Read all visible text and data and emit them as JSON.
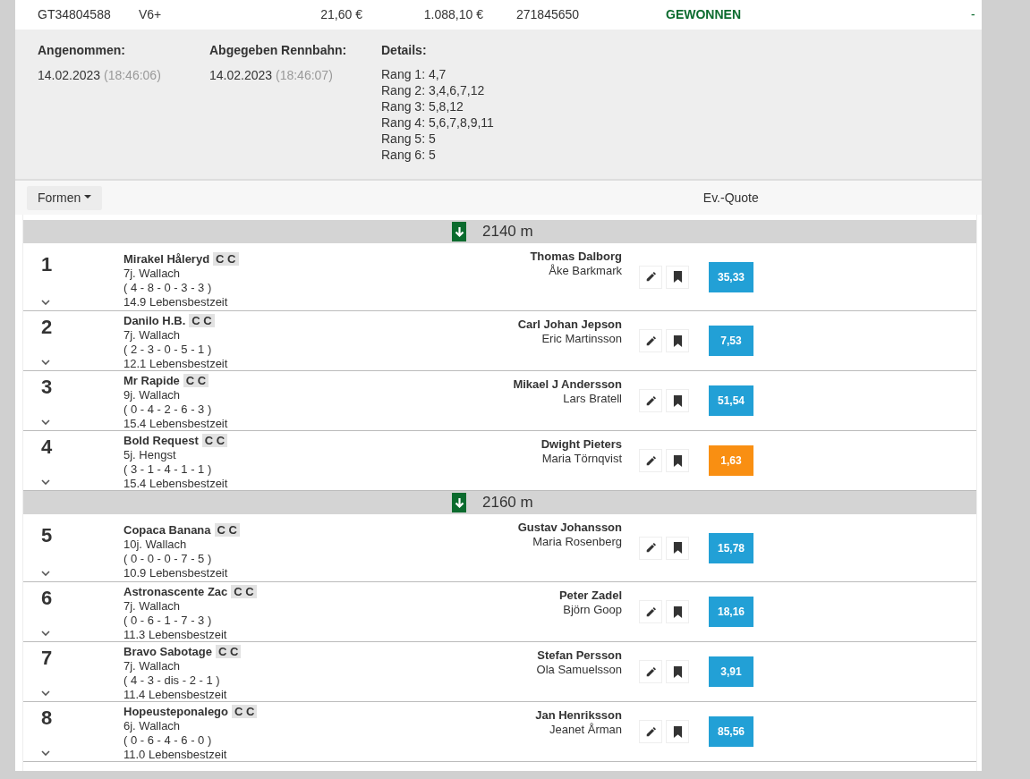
{
  "bet": {
    "id": "GT34804588",
    "type": "V6+",
    "stake": "21,60 €",
    "payout": "1.088,10 €",
    "number": "271845650",
    "status": "GEWONNEN",
    "result": "-"
  },
  "details": {
    "columns": [
      {
        "label": "Angenommen:",
        "date": "14.02.2023",
        "time": "(18:46:06)"
      },
      {
        "label": "Abgegeben Rennbahn:",
        "date": "14.02.2023",
        "time": "(18:46:07)"
      }
    ],
    "details_label": "Details:",
    "ranks": [
      "Rang 1: 4,7",
      "Rang 2: 3,4,6,7,12",
      "Rang 3: 5,8,12",
      "Rang 4: 5,6,7,8,9,11",
      "Rang 5: 5",
      "Rang 6: 5"
    ]
  },
  "toolbar": {
    "dropdown_label": "Formen",
    "column_label": "Ev.-Quote"
  },
  "groups": [
    {
      "distance": "2140 m",
      "runners": [
        {
          "number": "1",
          "name": "Mirakel Håleryd",
          "tag": "C C",
          "info": "7j. Wallach",
          "form": "( 4 - 8 - 0 - 3 - 3 )",
          "record": "14.9 Lebensbestzeit",
          "driver": "Thomas Dalborg",
          "trainer": "Åke Barkmark",
          "odds": "35,33",
          "favorite": false
        },
        {
          "number": "2",
          "name": "Danilo H.B.",
          "tag": "C C",
          "info": "7j. Wallach",
          "form": "( 2 - 3 - 0 - 5 - 1 )",
          "record": "12.1 Lebensbestzeit",
          "driver": "Carl Johan Jepson",
          "trainer": "Eric Martinsson",
          "odds": "7,53",
          "favorite": false
        },
        {
          "number": "3",
          "name": "Mr Rapide",
          "tag": "C C",
          "info": "9j. Wallach",
          "form": "( 0 - 4 - 2 - 6 - 3 )",
          "record": "15.4 Lebensbestzeit",
          "driver": "Mikael J Andersson",
          "trainer": "Lars Bratell",
          "odds": "51,54",
          "favorite": false
        },
        {
          "number": "4",
          "name": "Bold Request",
          "tag": "C C",
          "info": "5j. Hengst",
          "form": "( 3 - 1 - 4 - 1 - 1 )",
          "record": "15.4 Lebensbestzeit",
          "driver": "Dwight Pieters",
          "trainer": "Maria Törnqvist",
          "odds": "1,63",
          "favorite": true
        }
      ]
    },
    {
      "distance": "2160 m",
      "runners": [
        {
          "number": "5",
          "name": "Copaca Banana",
          "tag": "C C",
          "info": "10j. Wallach",
          "form": "( 0 - 0 - 0 - 7 - 5 )",
          "record": "10.9 Lebensbestzeit",
          "driver": "Gustav Johansson",
          "trainer": "Maria Rosenberg",
          "odds": "15,78",
          "favorite": false
        },
        {
          "number": "6",
          "name": "Astronascente Zac",
          "tag": "C C",
          "info": "7j. Wallach",
          "form": "( 0 - 6 - 1 - 7 - 3 )",
          "record": "11.3 Lebensbestzeit",
          "driver": "Peter Zadel",
          "trainer": "Björn Goop",
          "odds": "18,16",
          "favorite": false
        },
        {
          "number": "7",
          "name": "Bravo Sabotage",
          "tag": "C C",
          "info": "7j. Wallach",
          "form": "( 4 - 3 - dis - 2 - 1 )",
          "record": "11.4 Lebensbestzeit",
          "driver": "Stefan Persson",
          "trainer": "Ola Samuelsson",
          "odds": "3,91",
          "favorite": false
        },
        {
          "number": "8",
          "name": "Hopeusteponalego",
          "tag": "C C",
          "info": "6j. Wallach",
          "form": "( 0 - 6 - 4 - 6 - 0 )",
          "record": "11.0 Lebensbestzeit",
          "driver": "Jan Henriksson",
          "trainer": "Jeanet Årman",
          "odds": "85,56",
          "favorite": false
        }
      ]
    }
  ]
}
